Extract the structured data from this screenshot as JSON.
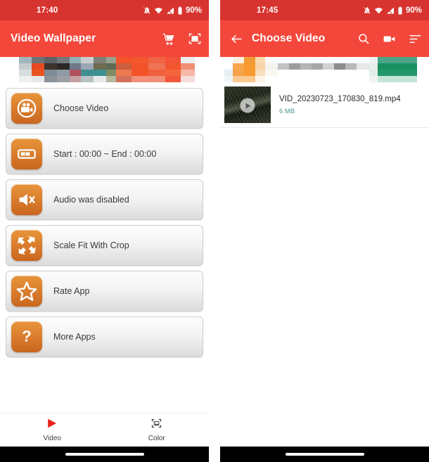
{
  "theme": {
    "statusbar_color": "#d8342f",
    "appbar_color": "#f4473b",
    "tile_color": "#dd8230",
    "accent_red": "#e8251c",
    "size_text_color": "#4a9a8f"
  },
  "left_phone": {
    "status": {
      "time": "17:40",
      "battery_percent": "90%",
      "icons": [
        "bell-off-icon",
        "wifi-icon",
        "signal-icon",
        "battery-icon"
      ]
    },
    "appbar": {
      "title": "Video Wallpaper",
      "actions": [
        {
          "name": "cart-icon",
          "label": "Cart"
        },
        {
          "name": "image-frame-icon",
          "label": "Wallpaper Preview"
        }
      ]
    },
    "ad_banner": {
      "label": "advertisement-banner"
    },
    "menu": [
      {
        "icon": "video-camera-icon",
        "label": "Choose Video"
      },
      {
        "icon": "trim-range-icon",
        "label": "Start : 00:00 ~ End : 00:00"
      },
      {
        "icon": "speaker-mute-icon",
        "label": "Audio was disabled"
      },
      {
        "icon": "scale-crop-icon",
        "label": "Scale Fit With Crop"
      },
      {
        "icon": "star-icon",
        "label": "Rate App"
      },
      {
        "icon": "question-mark-icon",
        "label": "More Apps"
      }
    ],
    "bottom_nav": [
      {
        "icon": "play-triangle-icon",
        "label": "Video",
        "active": true
      },
      {
        "icon": "color-frame-icon",
        "label": "Color",
        "active": false
      }
    ]
  },
  "right_phone": {
    "status": {
      "time": "17:45",
      "battery_percent": "90%",
      "icons": [
        "bell-off-icon",
        "wifi-icon",
        "signal-icon",
        "battery-icon"
      ]
    },
    "appbar": {
      "back": "back-arrow-icon",
      "title": "Choose Video",
      "actions": [
        {
          "name": "search-icon",
          "label": "Search"
        },
        {
          "name": "video-camera-icon",
          "label": "Record"
        },
        {
          "name": "sort-icon",
          "label": "Sort"
        }
      ]
    },
    "ad_banner": {
      "label": "advertisement-banner"
    },
    "videos": [
      {
        "name": "VID_20230723_170830_819.mp4",
        "size": "6 MB"
      }
    ]
  }
}
